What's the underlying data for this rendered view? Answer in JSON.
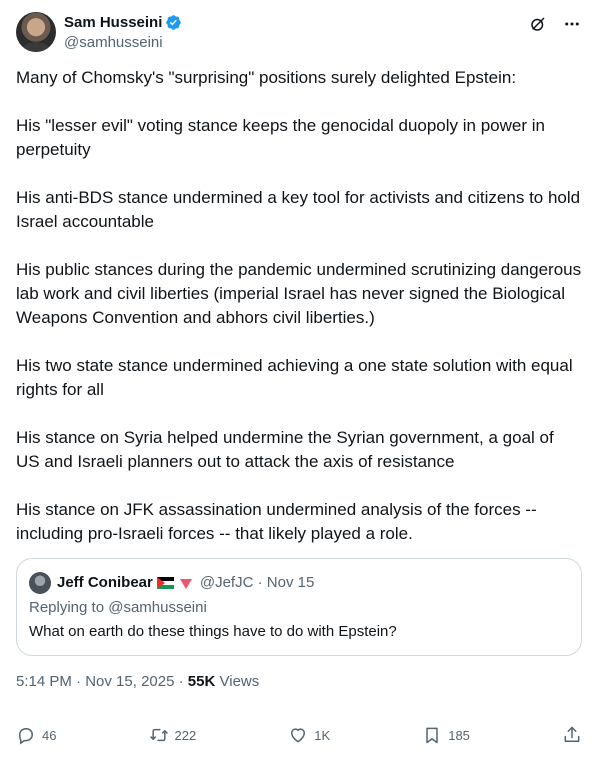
{
  "author": {
    "display_name": "Sam Husseini",
    "handle": "@samhusseini",
    "verified": true,
    "verified_color": "#1d9bf0"
  },
  "tweet": {
    "paragraphs": [
      "Many of Chomsky's \"surprising\" positions surely delighted Epstein:",
      "His \"lesser evil\" voting stance keeps the genocidal duopoly in power in perpetuity",
      "His anti-BDS stance undermined a key tool for activists and citizens to hold Israel accountable",
      "His public stances during the pandemic undermined scrutinizing dangerous lab work and civil liberties (imperial Israel has never signed the Biological Weapons Convention and abhors civil liberties.)",
      "His two state stance undermined achieving a one state solution with equal rights for all",
      "His stance on Syria helped undermine the Syrian government, a goal of US and Israeli planners out to attack the axis of resistance",
      "His stance on JFK assassination undermined analysis of the forces -- including pro-Israeli forces -- that likely played a role."
    ]
  },
  "quote": {
    "display_name": "Jeff Conibear",
    "handle": "@JefJC",
    "date": "Nov 15",
    "separator": "·",
    "replying_prefix": "Replying to",
    "replying_to": "@samhusseini",
    "text": "What on earth do these things have to do with Epstein?"
  },
  "meta": {
    "time": "5:14 PM",
    "date": "Nov 15, 2025",
    "separator": "·",
    "views_count": "55K",
    "views_label": "Views"
  },
  "actions": {
    "replies": "46",
    "reposts": "222",
    "likes": "1K",
    "bookmarks": "185"
  },
  "icons": [
    "verified-badge-icon",
    "grok-icon",
    "more-icon",
    "reply-icon",
    "repost-icon",
    "like-icon",
    "bookmark-icon",
    "share-icon"
  ]
}
